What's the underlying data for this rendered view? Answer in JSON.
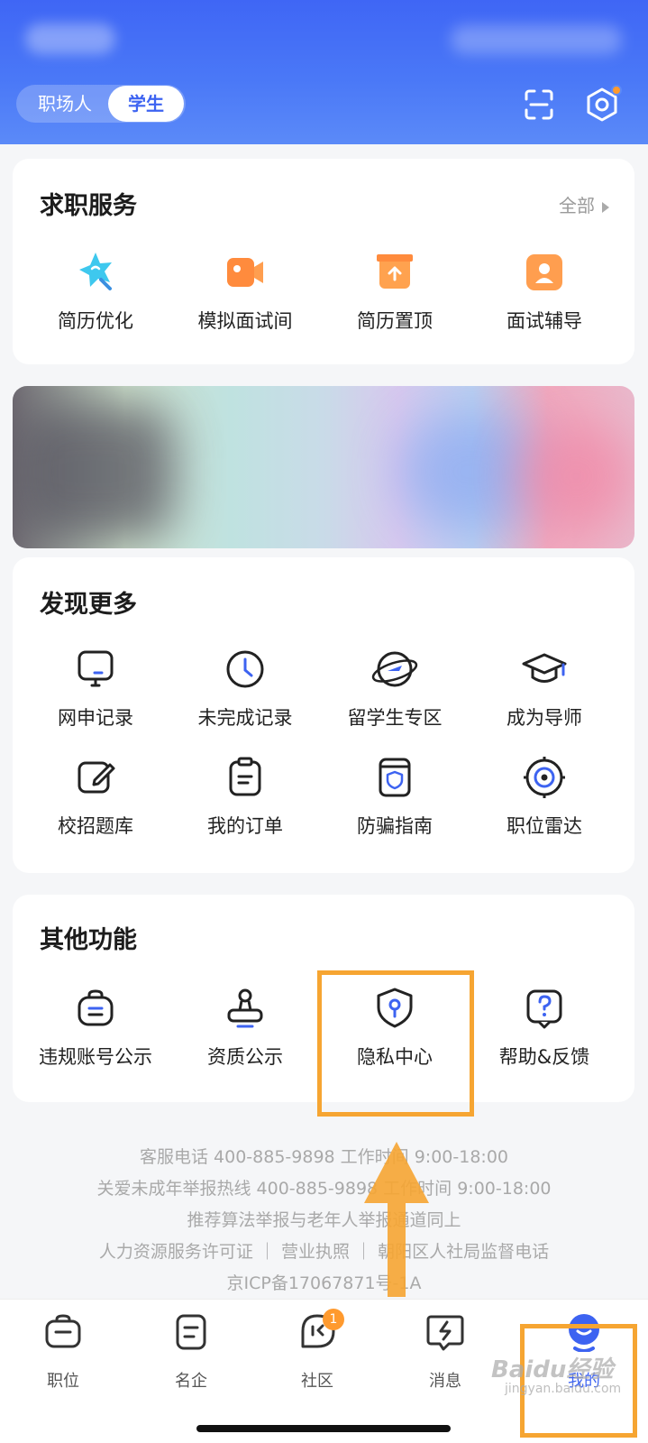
{
  "header": {
    "mode_tabs": [
      "职场人",
      "学生"
    ],
    "active_mode": "学生",
    "icons": [
      "scan-icon",
      "settings-icon"
    ],
    "accent": "#3d63f1"
  },
  "job_services": {
    "title": "求职服务",
    "all_label": "全部",
    "items": [
      {
        "label": "简历优化",
        "icon": "star-brush-icon"
      },
      {
        "label": "模拟面试间",
        "icon": "video-camera-icon"
      },
      {
        "label": "简历置顶",
        "icon": "box-up-icon"
      },
      {
        "label": "面试辅导",
        "icon": "person-card-icon"
      }
    ]
  },
  "discover": {
    "title": "发现更多",
    "items": [
      {
        "label": "网申记录",
        "icon": "monitor-icon"
      },
      {
        "label": "未完成记录",
        "icon": "clock-icon"
      },
      {
        "label": "留学生专区",
        "icon": "planet-plane-icon"
      },
      {
        "label": "成为导师",
        "icon": "graduation-cap-icon"
      },
      {
        "label": "校招题库",
        "icon": "edit-icon"
      },
      {
        "label": "我的订单",
        "icon": "clipboard-icon"
      },
      {
        "label": "防骗指南",
        "icon": "shield-book-icon"
      },
      {
        "label": "职位雷达",
        "icon": "radar-icon"
      }
    ]
  },
  "other": {
    "title": "其他功能",
    "items": [
      {
        "label": "违规账号公示",
        "icon": "bag-icon"
      },
      {
        "label": "资质公示",
        "icon": "stamp-icon"
      },
      {
        "label": "隐私中心",
        "icon": "privacy-shield-icon"
      },
      {
        "label": "帮助&反馈",
        "icon": "help-icon"
      }
    ]
  },
  "footer": {
    "lines": [
      "客服电话 400-885-9898  工作时间 9:00-18:00",
      "关爱未成年举报热线 400-885-9898  工作时间 9:00-18:00",
      "推荐算法举报与老年人举报通道同上",
      "人力资源服务许可证 ｜ 营业执照 ｜ 朝阳区人社局监督电话",
      "京ICP备17067871号-1A"
    ]
  },
  "tabbar": {
    "items": [
      {
        "label": "职位",
        "icon": "briefcase-icon"
      },
      {
        "label": "名企",
        "icon": "company-icon"
      },
      {
        "label": "社区",
        "icon": "chat-icon",
        "badge": "1"
      },
      {
        "label": "消息",
        "icon": "message-icon"
      },
      {
        "label": "我的",
        "icon": "profile-icon"
      }
    ],
    "active": "我的"
  },
  "annotation": {
    "highlight_color": "#f6a532",
    "watermark": "Baidu经验",
    "watermark_sub": "jingyan.baidu.com"
  }
}
